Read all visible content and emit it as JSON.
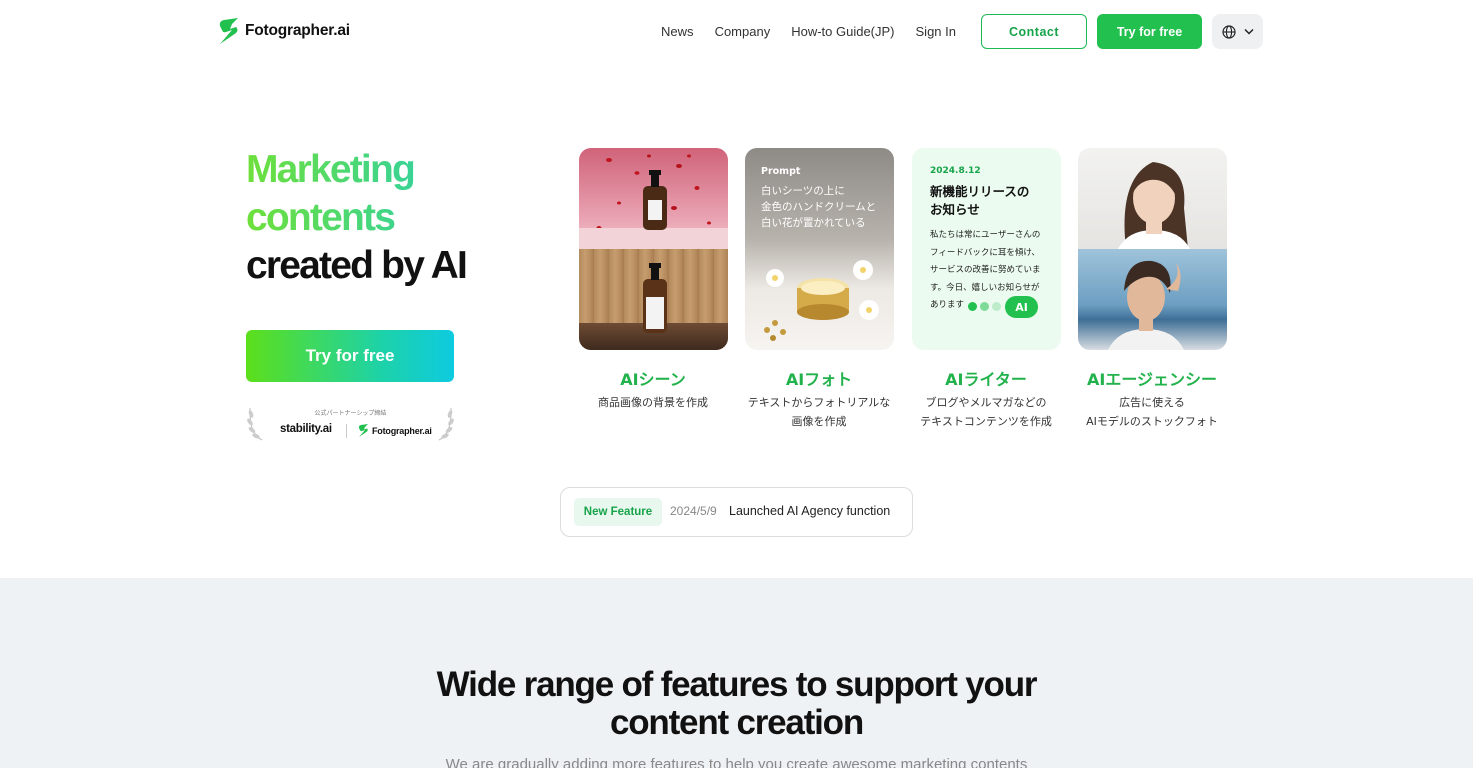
{
  "header": {
    "logo_text": "Fotographer.ai",
    "nav": [
      "News",
      "Company",
      "How-to Guide(JP)",
      "Sign In"
    ],
    "contact_label": "Contact",
    "try_label": "Try for free",
    "language_icon": "globe-icon"
  },
  "hero": {
    "title_line1": "Marketing",
    "title_line2": "contents",
    "title_line3": "created by AI",
    "cta_label": "Try for free",
    "partner_caption": "公式パートナーシップ締結",
    "partner_name": "stability.ai",
    "partner_self": "Fotographer.ai"
  },
  "cards": [
    {
      "title": "AIシーン",
      "desc_line1": "商品画像の背景を作成",
      "desc_line2": ""
    },
    {
      "title": "AIフォト",
      "desc_line1": "テキストからフォトリアルな",
      "desc_line2": "画像を作成",
      "prompt_label": "Prompt",
      "prompt_line1": "白いシーツの上に",
      "prompt_line2": "金色のハンドクリームと",
      "prompt_line3": "白い花が置かれている"
    },
    {
      "title": "AIライター",
      "desc_line1": "ブログやメルマガなどの",
      "desc_line2": "テキストコンテンツを作成",
      "date": "2024.8.12",
      "head_line1": "新機能リリースの",
      "head_line2": "お知らせ",
      "body_line1": "私たちは常にユーザーさんの",
      "body_line2": "フィードバックに耳を傾け、",
      "body_line3": "サービスの改善に努めていま",
      "body_line4": "す。今日、嬉しいお知らせが",
      "body_line5": "あります",
      "ai_label": "AI"
    },
    {
      "title": "AIエージェンシー",
      "desc_line1": "広告に使える",
      "desc_line2": "AIモデルのストックフォト"
    }
  ],
  "banner": {
    "badge": "New Feature",
    "date": "2024/5/9",
    "text": "Launched AI Agency function"
  },
  "features": {
    "title_line1": "Wide range of features to support your",
    "title_line2": "content creation",
    "subtitle": "We are gradually adding more features to help you create awesome marketing contents"
  },
  "colors": {
    "brand_green": "#22c04e",
    "accent_text": "#16a34a",
    "section_bg": "#eff2f5"
  }
}
